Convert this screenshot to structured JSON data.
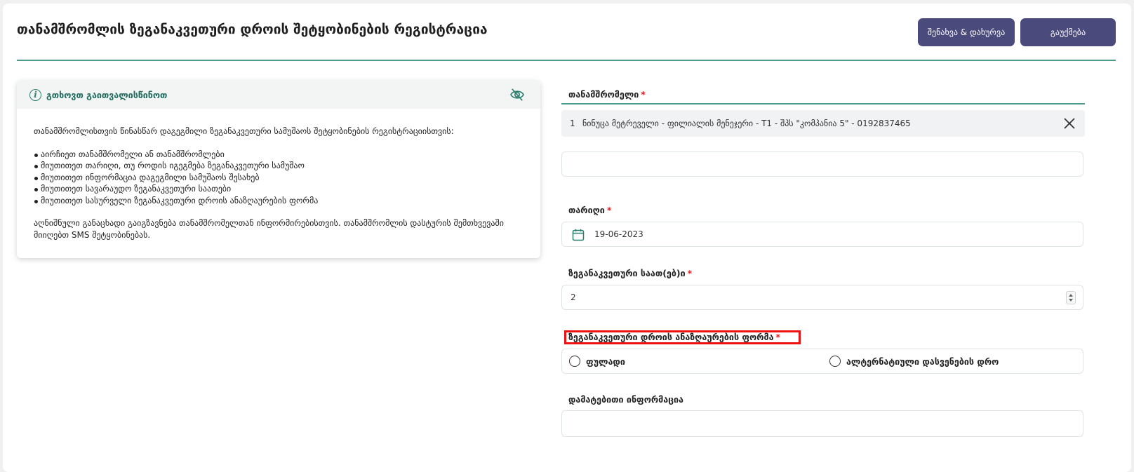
{
  "header": {
    "title": "თანამშრომლის ზეგანაკვეთური დროის შეტყობინების რეგისტრაცია",
    "save_close_label": "შენახვა & დახურვა",
    "cancel_label": "გაუქმება"
  },
  "info": {
    "heading": "გთხოვთ გაითვალისწინოთ",
    "intro": "თანამშრომლისთვის წინასწარ დაგეგმილი ზეგანაკვეთური სამუშაოს შეტყობინების რეგისტრაციისთვის:",
    "bullets": [
      "აირჩიეთ თანამშრომელი ან თანამშრომლები",
      "მიუთითეთ თარიღი, თუ როდის იგეგმება ზეგანაკვეთური სამუშაო",
      "მიუთითეთ ინფორმაცია დაგეგმილი სამუშაოს შესახებ",
      "მიუთითეთ სავარაუდო ზეგანაკვეთური საათები",
      "მიუთითეთ სასურველი ზეგანაკვეთური დროის ანაზღაურების ფორმა"
    ],
    "outro": "აღნიშნული განაცხადი გაიგზავნება თანამშრომელთან ინფორმირებისთვის. თანამშრომლის დასტურის შემთხვევაში მიიღებთ SMS შეტყობინებას.",
    "accent_color": "#2b7d6e"
  },
  "form": {
    "employee": {
      "label": "თანამშრომელი",
      "required": "*",
      "selected": {
        "number": "1",
        "text": "ნინუცა მეტრეველი - ფილიალის მენეჯერი - T1 - შპს \"კომპანია 5\" - 0192837465"
      },
      "search_value": ""
    },
    "date": {
      "label": "თარიღი",
      "required": "*",
      "value": "19-06-2023"
    },
    "hours": {
      "label": "ზეგანაკვეთური საათ(ებ)ი",
      "required": "*",
      "value": "2"
    },
    "compensation": {
      "label": "ზეგანაკვეთური დროის ანაზღაურების ფორმა",
      "required": "*",
      "options": [
        "ფულადი",
        "ალტერნატიული დასვენების დრო"
      ]
    },
    "additional": {
      "label": "დამატებითი ინფორმაცია",
      "value": ""
    }
  },
  "colors": {
    "button_bg": "#4a4a7c",
    "divider": "#4d9a8c",
    "required": "#e0232a",
    "highlight": "#ee1111"
  },
  "icons": {
    "info": "info-icon",
    "hide": "eye-off-icon",
    "remove": "close-icon",
    "date": "calendar-icon"
  }
}
